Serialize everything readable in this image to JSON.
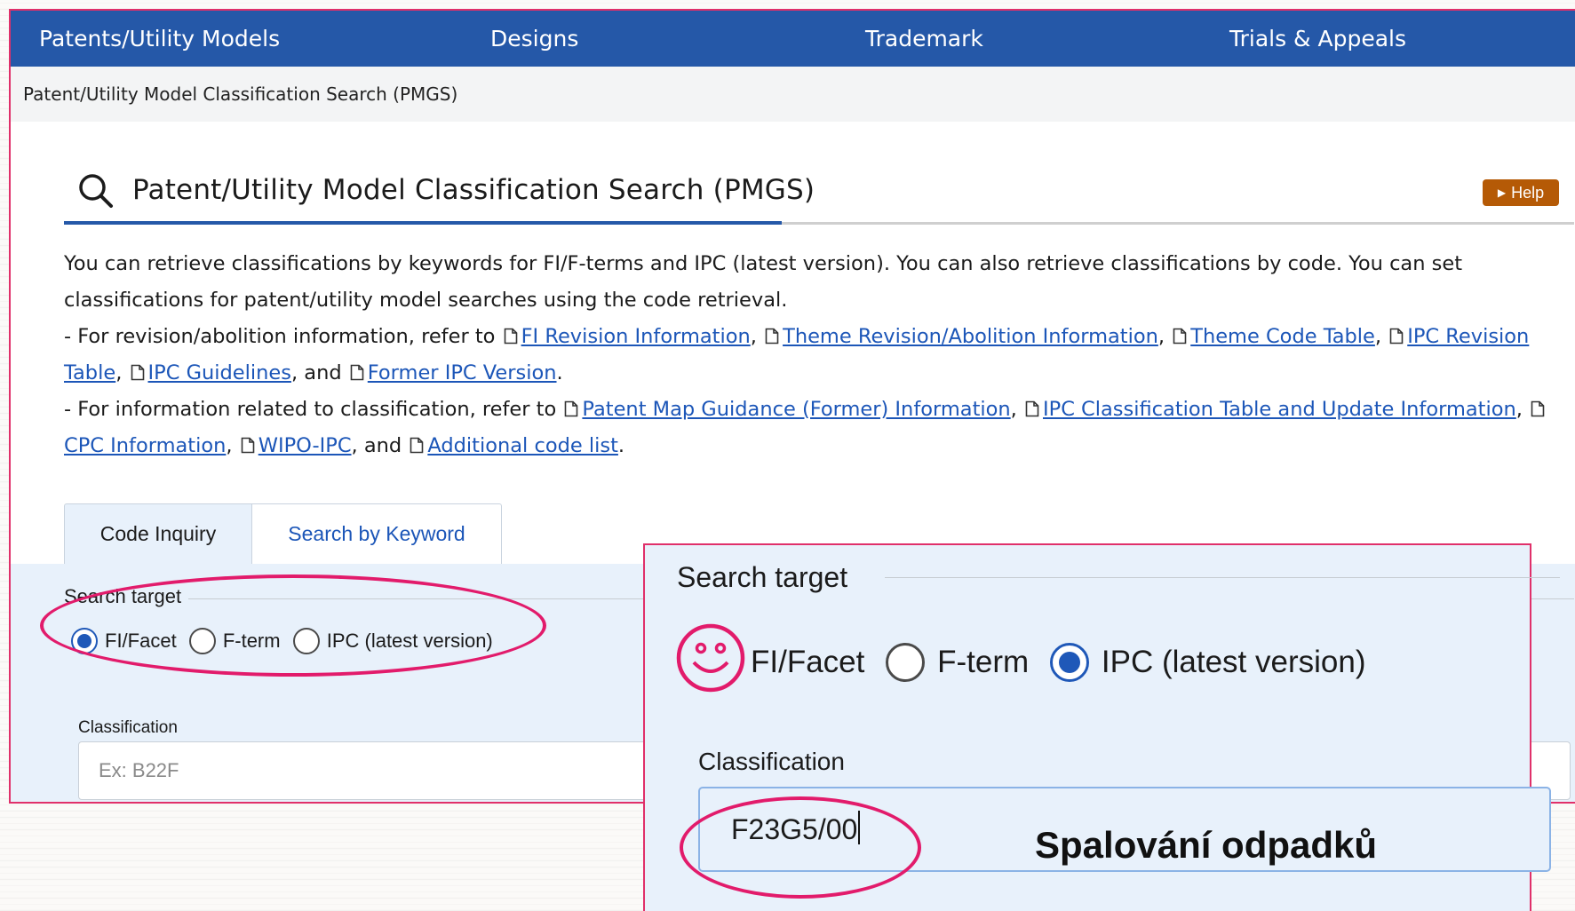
{
  "nav": {
    "items": [
      "Patents/Utility Models",
      "Designs",
      "Trademark",
      "Trials & Appeals"
    ]
  },
  "breadcrumb": "Patent/Utility Model Classification Search (PMGS)",
  "page": {
    "title": "Patent/Utility Model Classification Search (PMGS)",
    "help_label": "Help",
    "icons": [
      "search-icon",
      "doc-link-icon",
      "play-triangle-icon"
    ]
  },
  "description": {
    "line1": "You can retrieve classifications by keywords for FI/F-terms and IPC (latest version). You can also retrieve classifications by code. You can set classifications for patent/utility model searches using the code retrieval.",
    "revision_prefix": "- For revision/abolition information, refer to",
    "revision_links": [
      "FI Revision Information",
      "Theme Revision/Abolition Information",
      "Theme Code Table",
      "IPC Revision Table",
      "IPC Guidelines",
      "Former IPC Version"
    ],
    "related_prefix": "- For information related to classification, refer to",
    "related_links": [
      "Patent Map Guidance (Former) Information",
      "IPC Classification Table and Update Information",
      "CPC Information",
      "WIPO-IPC",
      "Additional code list"
    ],
    "and_word": "and"
  },
  "tabs": [
    "Code Inquiry",
    "Search by Keyword"
  ],
  "search_form": {
    "legend": "Search target",
    "options": [
      "FI/Facet",
      "F-term",
      "IPC (latest version)"
    ],
    "selected": "FI/Facet",
    "classification_label": "Classification",
    "classification_placeholder": "Ex: B22F"
  },
  "zoom_overlay": {
    "legend": "Search target",
    "options": [
      "FI/Facet",
      "F-term",
      "IPC (latest version)"
    ],
    "selected": "IPC (latest version)",
    "classification_label": "Classification",
    "classification_value": "F23G5/00",
    "annotation": "Spalování odpadků"
  },
  "colors": {
    "nav_bg": "#2558a8",
    "link": "#1c56b8",
    "help_bg": "#b55a06",
    "panel_bg": "#e8f1fb",
    "highlight": "#e21b6b"
  }
}
